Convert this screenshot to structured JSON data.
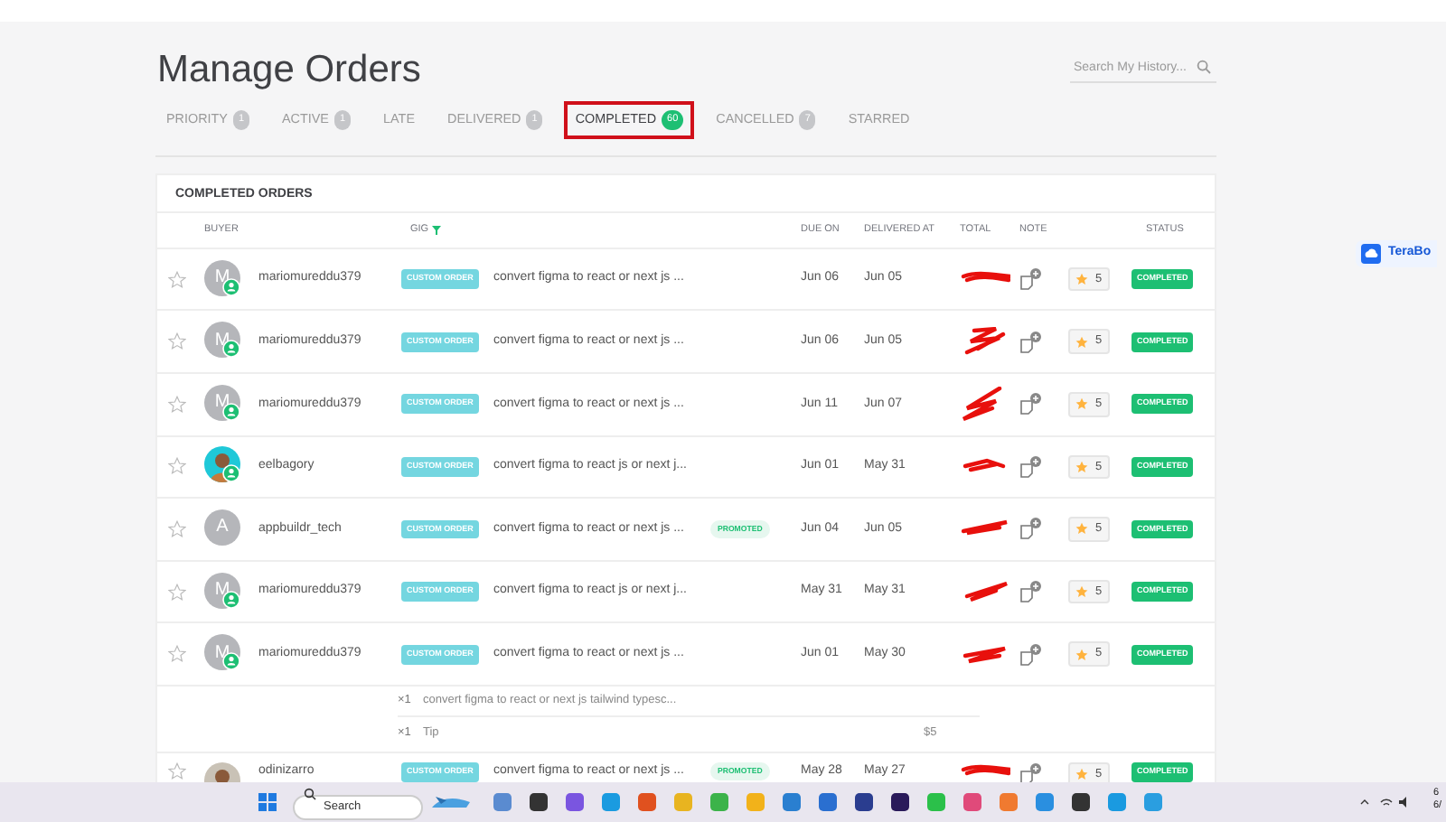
{
  "page": {
    "title": "Manage Orders",
    "search": {
      "placeholder": "Search My History..."
    }
  },
  "tabs": [
    {
      "label": "PRIORITY",
      "count": "1",
      "selected": false
    },
    {
      "label": "ACTIVE",
      "count": "1",
      "selected": false
    },
    {
      "label": "LATE",
      "selected": false
    },
    {
      "label": "DELIVERED",
      "count": "1",
      "selected": false
    },
    {
      "label": "COMPLETED",
      "count": "60",
      "selected": true
    },
    {
      "label": "CANCELLED",
      "count": "7",
      "selected": false
    },
    {
      "label": "STARRED",
      "selected": false
    }
  ],
  "table": {
    "title": "COMPLETED ORDERS",
    "columns": [
      "BUYER",
      "GIG",
      "DUE ON",
      "DELIVERED AT",
      "TOTAL",
      "NOTE",
      "STATUS"
    ],
    "rows": [
      {
        "starred": false,
        "avatar": {
          "kind": "letter",
          "initial": "M",
          "badge": true
        },
        "buyer": "mariomureddu379",
        "tag": "CUSTOM ORDER",
        "gig": "convert figma to react or next js ...",
        "due": "Jun 06",
        "delivered": "Jun 05",
        "rating": "5",
        "status": "COMPLETED"
      },
      {
        "starred": false,
        "avatar": {
          "kind": "letter",
          "initial": "M",
          "badge": true
        },
        "buyer": "mariomureddu379",
        "tag": "CUSTOM ORDER",
        "gig": "convert figma to react or next js ...",
        "due": "Jun 06",
        "delivered": "Jun 05",
        "rating": "5",
        "status": "COMPLETED"
      },
      {
        "starred": false,
        "avatar": {
          "kind": "letter",
          "initial": "M",
          "badge": true
        },
        "buyer": "mariomureddu379",
        "tag": "CUSTOM ORDER",
        "gig": "convert figma to react or next js ...",
        "due": "Jun 11",
        "delivered": "Jun 07",
        "rating": "5",
        "status": "COMPLETED"
      },
      {
        "starred": false,
        "avatar": {
          "kind": "picture",
          "badge": true
        },
        "buyer": "eelbagory",
        "tag": "CUSTOM ORDER",
        "gig": "convert figma to react js or next j...",
        "due": "Jun 01",
        "delivered": "May 31",
        "rating": "5",
        "status": "COMPLETED"
      },
      {
        "starred": false,
        "avatar": {
          "kind": "letter",
          "initial": "A",
          "badge": false
        },
        "buyer": "appbuildr_tech",
        "tag": "CUSTOM ORDER",
        "gig": "convert figma to react or next js ...",
        "promoted": "PROMOTED",
        "due": "Jun 04",
        "delivered": "Jun 05",
        "rating": "5",
        "status": "COMPLETED"
      },
      {
        "starred": false,
        "avatar": {
          "kind": "letter",
          "initial": "M",
          "badge": true
        },
        "buyer": "mariomureddu379",
        "tag": "CUSTOM ORDER",
        "gig": "convert figma to react js or next j...",
        "due": "May 31",
        "delivered": "May 31",
        "rating": "5",
        "status": "COMPLETED"
      },
      {
        "starred": false,
        "avatar": {
          "kind": "letter",
          "initial": "M",
          "badge": true
        },
        "buyer": "mariomureddu379",
        "tag": "CUSTOM ORDER",
        "gig": "convert figma to react or next js ...",
        "due": "Jun 01",
        "delivered": "May 30",
        "rating": "5",
        "status": "COMPLETED",
        "extras": [
          {
            "qty": "×1",
            "text": "convert figma to react or next js tailwind typesc..."
          },
          {
            "qty": "×1",
            "text": "Tip",
            "amount": "$5"
          }
        ]
      },
      {
        "starred": false,
        "avatar": {
          "kind": "picture",
          "badge": false
        },
        "buyer": "odinizarro",
        "tag": "CUSTOM ORDER",
        "gig": "convert figma to react or next js ...",
        "promoted": "PROMOTED",
        "due": "May 28",
        "delivered": "May 27",
        "rating": "5",
        "status": "COMPLETED"
      }
    ]
  },
  "side_button": {
    "label": "TeraBo"
  },
  "taskbar": {
    "search": {
      "placeholder": "Search"
    },
    "clock": [
      "6",
      "6/"
    ]
  }
}
